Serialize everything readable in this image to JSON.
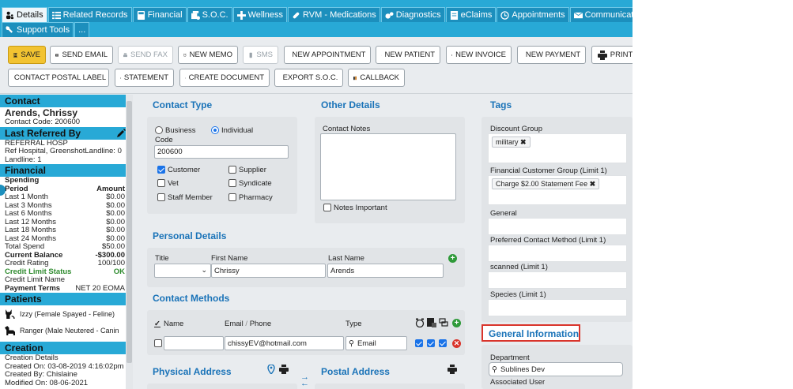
{
  "tabs": {
    "row1": [
      {
        "label": "Details",
        "icon": "people-icon",
        "active": true
      },
      {
        "label": "Related Records",
        "icon": "list-icon"
      },
      {
        "label": "Financial",
        "icon": "calculator-icon"
      },
      {
        "label": "S.O.C.",
        "icon": "soc-icon"
      },
      {
        "label": "Wellness",
        "icon": "plus-icon"
      },
      {
        "label": "RVM - Medications",
        "icon": "pill-icon"
      },
      {
        "label": "Diagnostics",
        "icon": "diagnostics-icon"
      },
      {
        "label": "eClaims",
        "icon": "document-icon"
      },
      {
        "label": "Appointments",
        "icon": "clock-icon"
      },
      {
        "label": "Communication",
        "icon": "envelope-icon"
      }
    ],
    "row2": [
      {
        "label": "Support Tools",
        "icon": "wrench-icon"
      },
      {
        "label": "...",
        "icon": ""
      }
    ]
  },
  "toolbar": {
    "row1": [
      {
        "label": "SAVE",
        "icon": "save-icon"
      },
      {
        "label": "SEND EMAIL",
        "icon": "email-icon"
      },
      {
        "label": "SEND FAX",
        "icon": "fax-icon"
      },
      {
        "label": "NEW MEMO",
        "icon": "memo-icon"
      },
      {
        "label": "SMS",
        "icon": "phone-icon"
      },
      {
        "label": "NEW APPOINTMENT",
        "icon": "clock-icon"
      },
      {
        "label": "NEW PATIENT",
        "icon": "paw-icon"
      },
      {
        "label": "NEW INVOICE",
        "icon": "invoice-icon"
      },
      {
        "label": "NEW PAYMENT",
        "icon": "payment-icon"
      },
      {
        "label": "PRINT",
        "icon": "print-icon"
      }
    ],
    "row2": [
      {
        "label": "CONTACT POSTAL LABEL",
        "icon": "print-icon"
      },
      {
        "label": "STATEMENT",
        "icon": "statement-icon"
      },
      {
        "label": "CREATE DOCUMENT",
        "icon": "document-icon"
      },
      {
        "label": "EXPORT S.O.C.",
        "icon": "export-icon"
      },
      {
        "label": "CALLBACK",
        "icon": "callback-icon"
      }
    ]
  },
  "sidebar": {
    "contact_heading": "Contact",
    "name": "Arends, Chrissy",
    "contact_code": "Contact Code: 200600",
    "last_referred_heading": "Last Referred By",
    "referral_lines": [
      "REFERRAL HOSP",
      "Ref Hospital, GreenshotLandline: 0",
      "Landline: 1"
    ],
    "financial_heading": "Financial",
    "spending_label": "Spending",
    "period_label": "Period",
    "amount_label": "Amount",
    "spending_rows": [
      {
        "period": "Last 1 Month",
        "amount": "$0.00"
      },
      {
        "period": "Last 3 Months",
        "amount": "$0.00"
      },
      {
        "period": "Last 6 Months",
        "amount": "$0.00"
      },
      {
        "period": "Last 12 Months",
        "amount": "$0.00"
      },
      {
        "period": "Last 18 Months",
        "amount": "$0.00"
      },
      {
        "period": "Last 24 Months",
        "amount": "$0.00"
      },
      {
        "period": "Total Spend",
        "amount": "$50.00"
      }
    ],
    "current_balance_label": "Current Balance",
    "current_balance": "-$300.00",
    "credit_rating_label": "Credit Rating",
    "credit_rating": "100/100",
    "credit_limit_status_label": "Credit Limit Status",
    "credit_limit_status": "OK",
    "credit_limit_name_label": "Credit Limit Name",
    "payment_terms_label": "Payment Terms",
    "payment_terms": "NET 20 EOMA",
    "patients_heading": "Patients",
    "patients": [
      "Izzy (Female Spayed - Feline)",
      "Ranger (Male Neutered - Canin"
    ],
    "creation_heading": "Creation",
    "creation_lines": [
      "Creation Details",
      "Created On: 03-08-2019 4:16:02pm",
      "Created By: Chislaine",
      "Modified On: 08-06-2021"
    ]
  },
  "contact_type": {
    "title": "Contact Type",
    "business": "Business",
    "individual": "Individual",
    "selected": "Individual",
    "code_label": "Code",
    "code_value": "200600",
    "checks": [
      {
        "label": "Customer",
        "checked": true
      },
      {
        "label": "Supplier",
        "checked": false
      },
      {
        "label": "Vet",
        "checked": false
      },
      {
        "label": "Syndicate",
        "checked": false
      },
      {
        "label": "Staff Member",
        "checked": false
      },
      {
        "label": "Pharmacy",
        "checked": false
      }
    ]
  },
  "other_details": {
    "title": "Other Details",
    "notes_label": "Contact Notes",
    "notes_value": "",
    "important_label": "Notes Important"
  },
  "tags": {
    "title": "Tags",
    "groups": [
      {
        "label": "Discount Group",
        "tags": [
          "military"
        ]
      },
      {
        "label": "Financial Customer Group (Limit 1)",
        "tags": [
          "Charge $2.00 Statement Fee"
        ]
      },
      {
        "label": "General",
        "tags": []
      },
      {
        "label": "Preferred Contact Method (Limit 1)",
        "tags": []
      },
      {
        "label": "scanned (Limit 1)",
        "tags": []
      },
      {
        "label": "Species (Limit 1)",
        "tags": []
      }
    ]
  },
  "personal_details": {
    "title": "Personal Details",
    "title_label": "Title",
    "title_value": "",
    "first_name_label": "First Name",
    "first_name": "Chrissy",
    "last_name_label": "Last Name",
    "last_name": "Arends"
  },
  "contact_methods": {
    "title": "Contact Methods",
    "name_header": "Name",
    "email_header": "Email",
    "slash": "/",
    "phone_header": "Phone",
    "type_header": "Type",
    "rows": [
      {
        "name": "",
        "value": "chissyEV@hotmail.com",
        "type": "Email"
      }
    ]
  },
  "general_information": {
    "title": "General Information",
    "department_label": "Department",
    "department_value": "Sublines Dev",
    "associated_user_label": "Associated User",
    "highlight_color": "#d9342b"
  },
  "physical_address": {
    "title": "Physical Address"
  },
  "postal_address": {
    "title": "Postal Address"
  },
  "colors": {
    "accent": "#28a9d6",
    "section_title": "#1a73b8",
    "save": "#f2c331"
  }
}
